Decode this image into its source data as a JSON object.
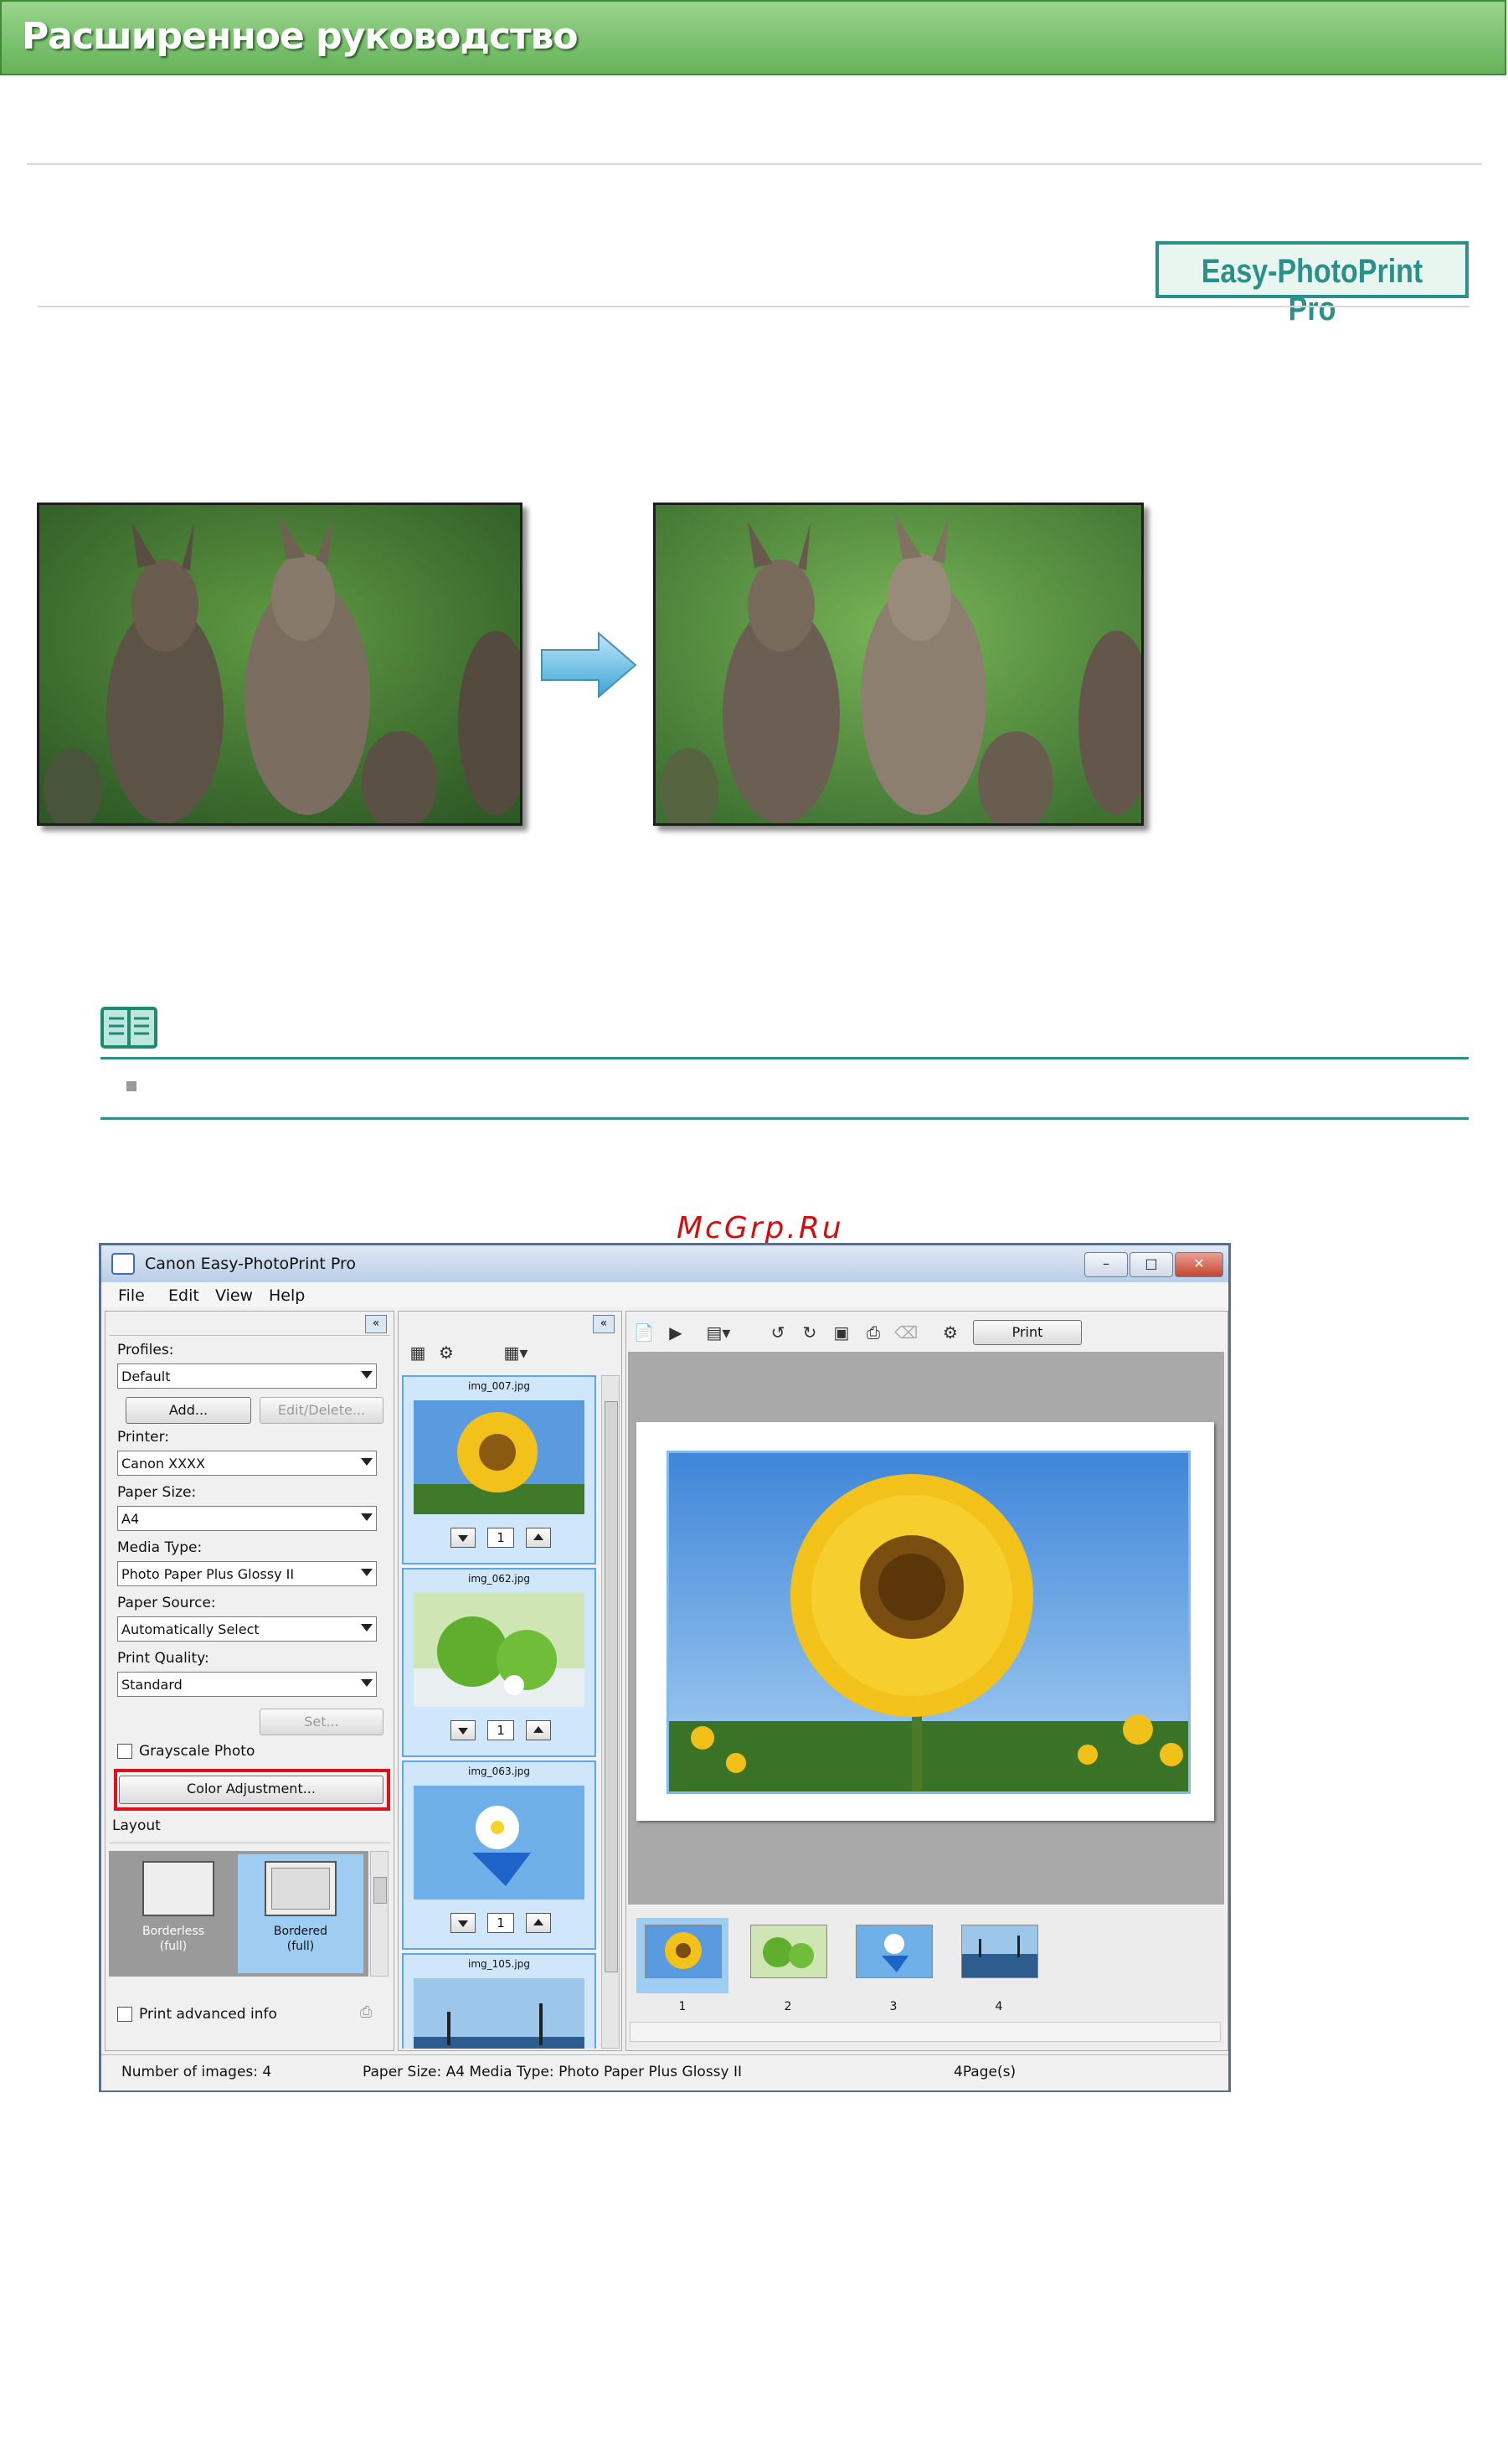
{
  "header": {
    "title": "Расширенное руководство"
  },
  "badge": {
    "label": "Easy-PhotoPrint Pro"
  },
  "watermark": "McGrp.Ru",
  "window": {
    "title": "Canon Easy-PhotoPrint Pro",
    "menu": [
      "File",
      "Edit",
      "View",
      "Help"
    ],
    "settings": {
      "profiles_label": "Profiles:",
      "profiles_value": "Default",
      "add_label": "Add...",
      "edit_delete_label": "Edit/Delete...",
      "printer_label": "Printer:",
      "printer_value": "Canon XXXX",
      "paper_size_label": "Paper Size:",
      "paper_size_value": "A4",
      "media_type_label": "Media Type:",
      "media_type_value": "Photo Paper Plus Glossy II",
      "paper_source_label": "Paper Source:",
      "paper_source_value": "Automatically Select",
      "print_quality_label": "Print Quality:",
      "print_quality_value": "Standard",
      "set_label": "Set...",
      "grayscale_label": "Grayscale Photo",
      "color_adjustment_label": "Color Adjustment...",
      "layout_label": "Layout",
      "layout_options": [
        {
          "name": "Borderless",
          "sub": "(full)"
        },
        {
          "name": "Bordered",
          "sub": "(full)"
        }
      ],
      "print_advanced_label": "Print advanced info"
    },
    "thumbnails": [
      {
        "file": "img_007.jpg",
        "count": "1"
      },
      {
        "file": "img_062.jpg",
        "count": "1"
      },
      {
        "file": "img_063.jpg",
        "count": "1"
      },
      {
        "file": "img_105.jpg"
      }
    ],
    "print_button": "Print",
    "pages": [
      "1",
      "2",
      "3",
      "4"
    ],
    "status": {
      "images": "Number of images: 4",
      "paper": "Paper Size: A4  Media Type: Photo Paper Plus Glossy II",
      "pages": "4Page(s)"
    }
  }
}
